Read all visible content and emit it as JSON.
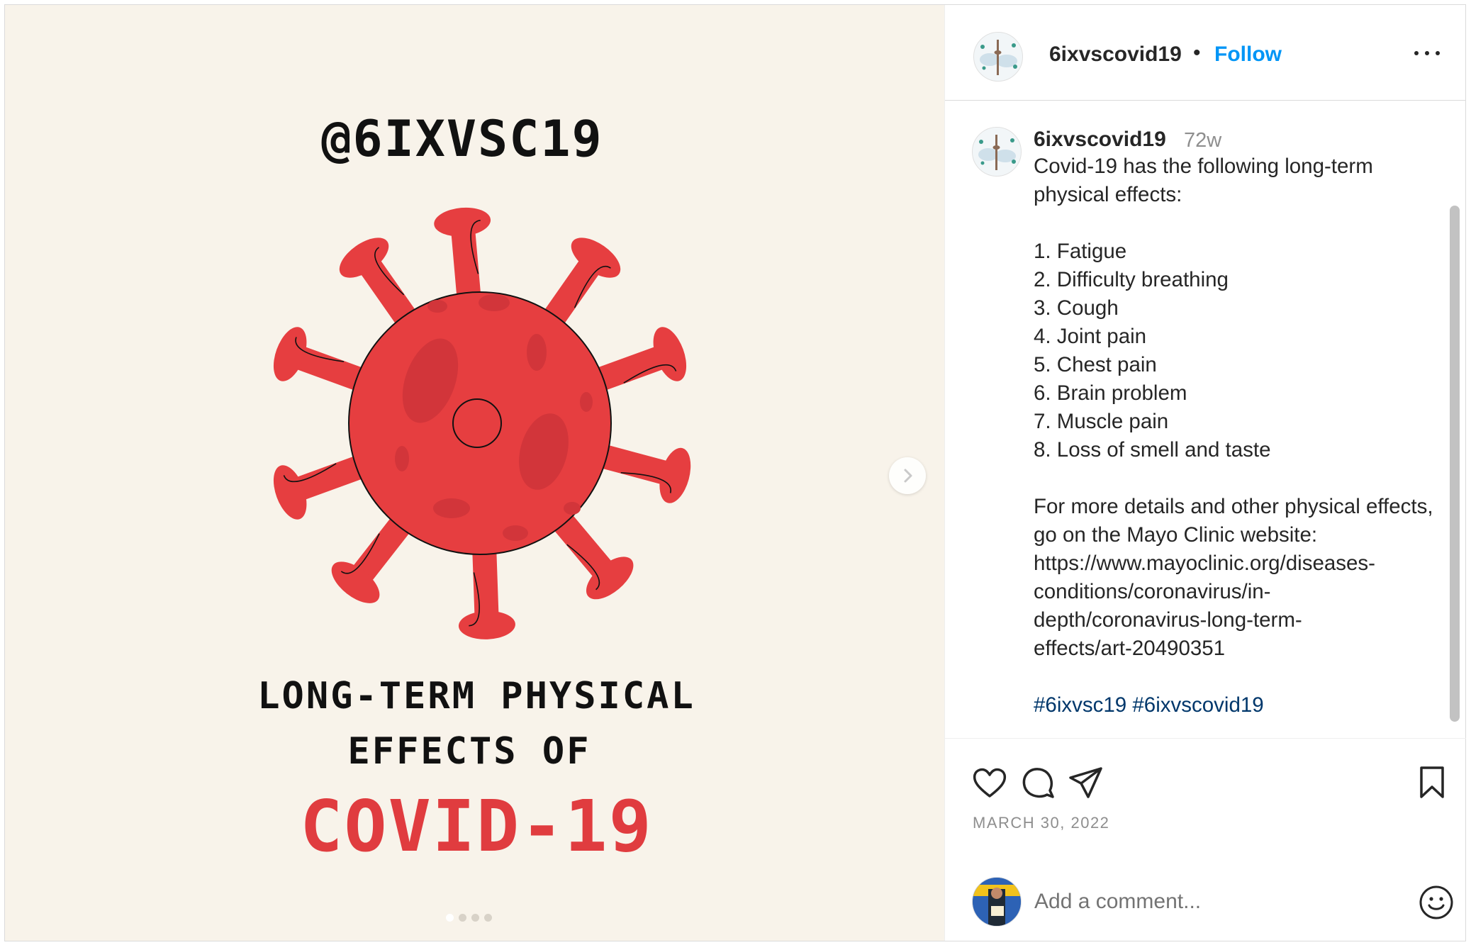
{
  "media": {
    "handle_text": "@6IXVSC19",
    "line1": "LONG-TERM PHYSICAL",
    "line2": "EFFECTS OF",
    "line3": "COVID-19",
    "accent_color": "#e03c3f",
    "background_color": "#f8f3ea",
    "carousel": {
      "total": 4,
      "active": 1
    },
    "next_icon": "chevron-right-icon"
  },
  "header": {
    "username": "6ixvscovid19",
    "separator": "•",
    "follow_label": "Follow",
    "more_icon": "more-horizontal-icon"
  },
  "caption": {
    "username": "6ixvscovid19",
    "time_ago": "72w",
    "intro": "Covid-19 has the following long-term physical effects:",
    "list": [
      "1. Fatigue",
      "2. Difficulty breathing",
      "3. Cough",
      "4. Joint pain",
      "5. Chest pain",
      "6. Brain problem",
      "7. Muscle pain",
      "8. Loss of smell and taste"
    ],
    "more_info": "For more details and other physical effects, go on the Mayo Clinic website:",
    "url_lines": [
      "https://www.mayoclinic.org/diseases-",
      "conditions/coronavirus/in-",
      "depth/coronavirus-long-term-",
      "effects/art-20490351"
    ],
    "hashtags": "#6ixvsc19 #6ixvscovid19"
  },
  "actions": {
    "like_icon": "heart-icon",
    "comment_icon": "comment-icon",
    "share_icon": "paper-plane-icon",
    "save_icon": "bookmark-icon",
    "date": "MARCH 30, 2022"
  },
  "comment": {
    "placeholder": "Add a comment...",
    "emoji_icon": "smiley-icon"
  },
  "colors": {
    "link_blue": "#0095f6",
    "hashtag_blue": "#00376b",
    "muted_gray": "#8e8e8e"
  }
}
